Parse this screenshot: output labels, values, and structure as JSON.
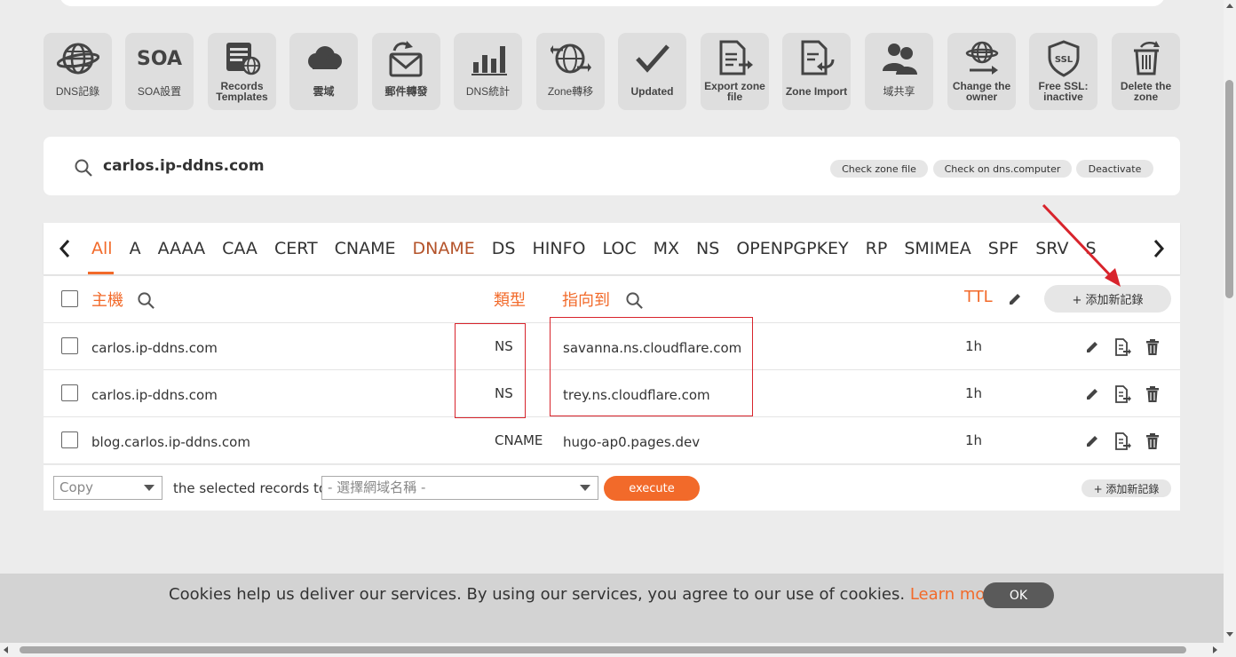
{
  "toolbar": [
    {
      "label": "DNS記錄",
      "icon": "dns-globe-icon"
    },
    {
      "label": "SOA設置",
      "icon": "soa-icon",
      "icon_text": "SOA"
    },
    {
      "label": "Records Templates",
      "icon": "records-templates-icon"
    },
    {
      "label": "雲域",
      "icon": "cloud-icon"
    },
    {
      "label": "郵件轉發",
      "icon": "mail-forward-icon"
    },
    {
      "label": "DNS統計",
      "icon": "bar-chart-icon"
    },
    {
      "label": "Zone轉移",
      "icon": "zone-transfer-icon"
    },
    {
      "label": "Updated",
      "icon": "checkmark-icon"
    },
    {
      "label": "Export zone file",
      "icon": "export-file-icon"
    },
    {
      "label": "Zone Import",
      "icon": "import-file-icon"
    },
    {
      "label": "域共享",
      "icon": "users-icon"
    },
    {
      "label": "Change the owner",
      "icon": "change-owner-icon"
    },
    {
      "label": "Free SSL: inactive",
      "icon": "ssl-shield-icon",
      "icon_text": "SSL"
    },
    {
      "label": "Delete the zone",
      "icon": "trash-icon"
    }
  ],
  "zone": {
    "domain": "carlos.ip-ddns.com",
    "actions": [
      "Check zone file",
      "Check on dns.computer",
      "Deactivate"
    ]
  },
  "record_tabs": [
    "All",
    "A",
    "AAAA",
    "CAA",
    "CERT",
    "CNAME",
    "DNAME",
    "DS",
    "HINFO",
    "LOC",
    "MX",
    "NS",
    "OPENPGPKEY",
    "RP",
    "SMIMEA",
    "SPF",
    "SRV",
    "S"
  ],
  "active_tab": "All",
  "table": {
    "headers": {
      "host": "主機",
      "type": "類型",
      "points_to": "指向到",
      "ttl": "TTL"
    },
    "add_record_label": "+ 添加新記錄",
    "rows": [
      {
        "host": "carlos.ip-ddns.com",
        "type": "NS",
        "value": "savanna.ns.cloudflare.com",
        "ttl": "1h"
      },
      {
        "host": "carlos.ip-ddns.com",
        "type": "NS",
        "value": "trey.ns.cloudflare.com",
        "ttl": "1h"
      },
      {
        "host": "blog.carlos.ip-ddns.com",
        "type": "CNAME",
        "value": "hugo-ap0.pages.dev",
        "ttl": "1h"
      }
    ]
  },
  "bulk": {
    "action_select": "Copy",
    "middle_text": "the selected records to",
    "domain_select": "- 選擇網域名稱 -",
    "execute_label": "execute",
    "add_record_label": "+ 添加新記錄"
  },
  "cookie": {
    "message": "Cookies help us deliver our services. By using our services, you agree to our use of cookies.",
    "learn_more": "Learn more",
    "ok": "OK"
  },
  "colors": {
    "accent": "#f26a2a",
    "annotation": "#d8242c"
  }
}
